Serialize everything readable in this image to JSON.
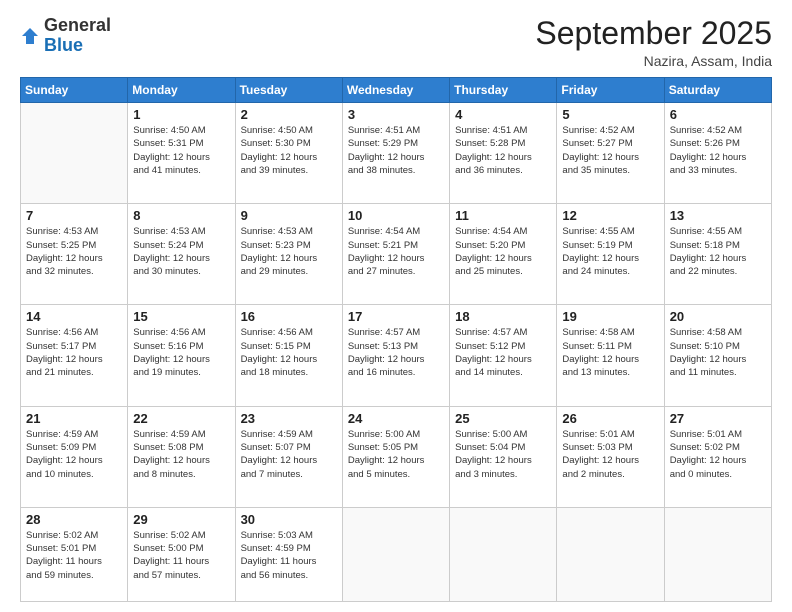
{
  "header": {
    "logo_general": "General",
    "logo_blue": "Blue",
    "month_title": "September 2025",
    "location": "Nazira, Assam, India"
  },
  "weekdays": [
    "Sunday",
    "Monday",
    "Tuesday",
    "Wednesday",
    "Thursday",
    "Friday",
    "Saturday"
  ],
  "weeks": [
    [
      {
        "day": "",
        "info": ""
      },
      {
        "day": "1",
        "info": "Sunrise: 4:50 AM\nSunset: 5:31 PM\nDaylight: 12 hours\nand 41 minutes."
      },
      {
        "day": "2",
        "info": "Sunrise: 4:50 AM\nSunset: 5:30 PM\nDaylight: 12 hours\nand 39 minutes."
      },
      {
        "day": "3",
        "info": "Sunrise: 4:51 AM\nSunset: 5:29 PM\nDaylight: 12 hours\nand 38 minutes."
      },
      {
        "day": "4",
        "info": "Sunrise: 4:51 AM\nSunset: 5:28 PM\nDaylight: 12 hours\nand 36 minutes."
      },
      {
        "day": "5",
        "info": "Sunrise: 4:52 AM\nSunset: 5:27 PM\nDaylight: 12 hours\nand 35 minutes."
      },
      {
        "day": "6",
        "info": "Sunrise: 4:52 AM\nSunset: 5:26 PM\nDaylight: 12 hours\nand 33 minutes."
      }
    ],
    [
      {
        "day": "7",
        "info": "Sunrise: 4:53 AM\nSunset: 5:25 PM\nDaylight: 12 hours\nand 32 minutes."
      },
      {
        "day": "8",
        "info": "Sunrise: 4:53 AM\nSunset: 5:24 PM\nDaylight: 12 hours\nand 30 minutes."
      },
      {
        "day": "9",
        "info": "Sunrise: 4:53 AM\nSunset: 5:23 PM\nDaylight: 12 hours\nand 29 minutes."
      },
      {
        "day": "10",
        "info": "Sunrise: 4:54 AM\nSunset: 5:21 PM\nDaylight: 12 hours\nand 27 minutes."
      },
      {
        "day": "11",
        "info": "Sunrise: 4:54 AM\nSunset: 5:20 PM\nDaylight: 12 hours\nand 25 minutes."
      },
      {
        "day": "12",
        "info": "Sunrise: 4:55 AM\nSunset: 5:19 PM\nDaylight: 12 hours\nand 24 minutes."
      },
      {
        "day": "13",
        "info": "Sunrise: 4:55 AM\nSunset: 5:18 PM\nDaylight: 12 hours\nand 22 minutes."
      }
    ],
    [
      {
        "day": "14",
        "info": "Sunrise: 4:56 AM\nSunset: 5:17 PM\nDaylight: 12 hours\nand 21 minutes."
      },
      {
        "day": "15",
        "info": "Sunrise: 4:56 AM\nSunset: 5:16 PM\nDaylight: 12 hours\nand 19 minutes."
      },
      {
        "day": "16",
        "info": "Sunrise: 4:56 AM\nSunset: 5:15 PM\nDaylight: 12 hours\nand 18 minutes."
      },
      {
        "day": "17",
        "info": "Sunrise: 4:57 AM\nSunset: 5:13 PM\nDaylight: 12 hours\nand 16 minutes."
      },
      {
        "day": "18",
        "info": "Sunrise: 4:57 AM\nSunset: 5:12 PM\nDaylight: 12 hours\nand 14 minutes."
      },
      {
        "day": "19",
        "info": "Sunrise: 4:58 AM\nSunset: 5:11 PM\nDaylight: 12 hours\nand 13 minutes."
      },
      {
        "day": "20",
        "info": "Sunrise: 4:58 AM\nSunset: 5:10 PM\nDaylight: 12 hours\nand 11 minutes."
      }
    ],
    [
      {
        "day": "21",
        "info": "Sunrise: 4:59 AM\nSunset: 5:09 PM\nDaylight: 12 hours\nand 10 minutes."
      },
      {
        "day": "22",
        "info": "Sunrise: 4:59 AM\nSunset: 5:08 PM\nDaylight: 12 hours\nand 8 minutes."
      },
      {
        "day": "23",
        "info": "Sunrise: 4:59 AM\nSunset: 5:07 PM\nDaylight: 12 hours\nand 7 minutes."
      },
      {
        "day": "24",
        "info": "Sunrise: 5:00 AM\nSunset: 5:05 PM\nDaylight: 12 hours\nand 5 minutes."
      },
      {
        "day": "25",
        "info": "Sunrise: 5:00 AM\nSunset: 5:04 PM\nDaylight: 12 hours\nand 3 minutes."
      },
      {
        "day": "26",
        "info": "Sunrise: 5:01 AM\nSunset: 5:03 PM\nDaylight: 12 hours\nand 2 minutes."
      },
      {
        "day": "27",
        "info": "Sunrise: 5:01 AM\nSunset: 5:02 PM\nDaylight: 12 hours\nand 0 minutes."
      }
    ],
    [
      {
        "day": "28",
        "info": "Sunrise: 5:02 AM\nSunset: 5:01 PM\nDaylight: 11 hours\nand 59 minutes."
      },
      {
        "day": "29",
        "info": "Sunrise: 5:02 AM\nSunset: 5:00 PM\nDaylight: 11 hours\nand 57 minutes."
      },
      {
        "day": "30",
        "info": "Sunrise: 5:03 AM\nSunset: 4:59 PM\nDaylight: 11 hours\nand 56 minutes."
      },
      {
        "day": "",
        "info": ""
      },
      {
        "day": "",
        "info": ""
      },
      {
        "day": "",
        "info": ""
      },
      {
        "day": "",
        "info": ""
      }
    ]
  ]
}
